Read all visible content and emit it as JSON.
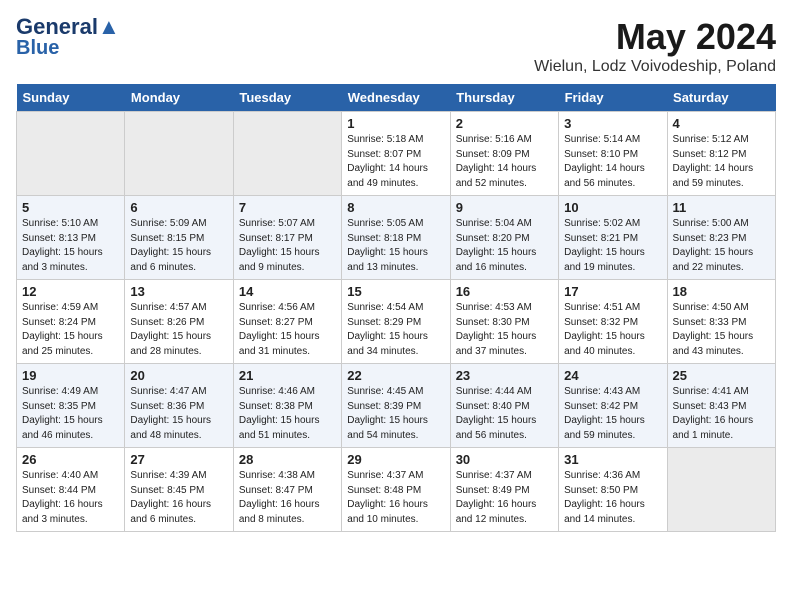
{
  "header": {
    "logo_line1": "General",
    "logo_line2": "Blue",
    "month_title": "May 2024",
    "location": "Wielun, Lodz Voivodeship, Poland"
  },
  "weekdays": [
    "Sunday",
    "Monday",
    "Tuesday",
    "Wednesday",
    "Thursday",
    "Friday",
    "Saturday"
  ],
  "weeks": [
    [
      {
        "day": "",
        "empty": true
      },
      {
        "day": "",
        "empty": true
      },
      {
        "day": "",
        "empty": true
      },
      {
        "day": "1",
        "sunrise": "5:18 AM",
        "sunset": "8:07 PM",
        "daylight": "14 hours and 49 minutes."
      },
      {
        "day": "2",
        "sunrise": "5:16 AM",
        "sunset": "8:09 PM",
        "daylight": "14 hours and 52 minutes."
      },
      {
        "day": "3",
        "sunrise": "5:14 AM",
        "sunset": "8:10 PM",
        "daylight": "14 hours and 56 minutes."
      },
      {
        "day": "4",
        "sunrise": "5:12 AM",
        "sunset": "8:12 PM",
        "daylight": "14 hours and 59 minutes."
      }
    ],
    [
      {
        "day": "5",
        "sunrise": "5:10 AM",
        "sunset": "8:13 PM",
        "daylight": "15 hours and 3 minutes."
      },
      {
        "day": "6",
        "sunrise": "5:09 AM",
        "sunset": "8:15 PM",
        "daylight": "15 hours and 6 minutes."
      },
      {
        "day": "7",
        "sunrise": "5:07 AM",
        "sunset": "8:17 PM",
        "daylight": "15 hours and 9 minutes."
      },
      {
        "day": "8",
        "sunrise": "5:05 AM",
        "sunset": "8:18 PM",
        "daylight": "15 hours and 13 minutes."
      },
      {
        "day": "9",
        "sunrise": "5:04 AM",
        "sunset": "8:20 PM",
        "daylight": "15 hours and 16 minutes."
      },
      {
        "day": "10",
        "sunrise": "5:02 AM",
        "sunset": "8:21 PM",
        "daylight": "15 hours and 19 minutes."
      },
      {
        "day": "11",
        "sunrise": "5:00 AM",
        "sunset": "8:23 PM",
        "daylight": "15 hours and 22 minutes."
      }
    ],
    [
      {
        "day": "12",
        "sunrise": "4:59 AM",
        "sunset": "8:24 PM",
        "daylight": "15 hours and 25 minutes."
      },
      {
        "day": "13",
        "sunrise": "4:57 AM",
        "sunset": "8:26 PM",
        "daylight": "15 hours and 28 minutes."
      },
      {
        "day": "14",
        "sunrise": "4:56 AM",
        "sunset": "8:27 PM",
        "daylight": "15 hours and 31 minutes."
      },
      {
        "day": "15",
        "sunrise": "4:54 AM",
        "sunset": "8:29 PM",
        "daylight": "15 hours and 34 minutes."
      },
      {
        "day": "16",
        "sunrise": "4:53 AM",
        "sunset": "8:30 PM",
        "daylight": "15 hours and 37 minutes."
      },
      {
        "day": "17",
        "sunrise": "4:51 AM",
        "sunset": "8:32 PM",
        "daylight": "15 hours and 40 minutes."
      },
      {
        "day": "18",
        "sunrise": "4:50 AM",
        "sunset": "8:33 PM",
        "daylight": "15 hours and 43 minutes."
      }
    ],
    [
      {
        "day": "19",
        "sunrise": "4:49 AM",
        "sunset": "8:35 PM",
        "daylight": "15 hours and 46 minutes."
      },
      {
        "day": "20",
        "sunrise": "4:47 AM",
        "sunset": "8:36 PM",
        "daylight": "15 hours and 48 minutes."
      },
      {
        "day": "21",
        "sunrise": "4:46 AM",
        "sunset": "8:38 PM",
        "daylight": "15 hours and 51 minutes."
      },
      {
        "day": "22",
        "sunrise": "4:45 AM",
        "sunset": "8:39 PM",
        "daylight": "15 hours and 54 minutes."
      },
      {
        "day": "23",
        "sunrise": "4:44 AM",
        "sunset": "8:40 PM",
        "daylight": "15 hours and 56 minutes."
      },
      {
        "day": "24",
        "sunrise": "4:43 AM",
        "sunset": "8:42 PM",
        "daylight": "15 hours and 59 minutes."
      },
      {
        "day": "25",
        "sunrise": "4:41 AM",
        "sunset": "8:43 PM",
        "daylight": "16 hours and 1 minute."
      }
    ],
    [
      {
        "day": "26",
        "sunrise": "4:40 AM",
        "sunset": "8:44 PM",
        "daylight": "16 hours and 3 minutes."
      },
      {
        "day": "27",
        "sunrise": "4:39 AM",
        "sunset": "8:45 PM",
        "daylight": "16 hours and 6 minutes."
      },
      {
        "day": "28",
        "sunrise": "4:38 AM",
        "sunset": "8:47 PM",
        "daylight": "16 hours and 8 minutes."
      },
      {
        "day": "29",
        "sunrise": "4:37 AM",
        "sunset": "8:48 PM",
        "daylight": "16 hours and 10 minutes."
      },
      {
        "day": "30",
        "sunrise": "4:37 AM",
        "sunset": "8:49 PM",
        "daylight": "16 hours and 12 minutes."
      },
      {
        "day": "31",
        "sunrise": "4:36 AM",
        "sunset": "8:50 PM",
        "daylight": "16 hours and 14 minutes."
      },
      {
        "day": "",
        "empty": true
      }
    ]
  ]
}
